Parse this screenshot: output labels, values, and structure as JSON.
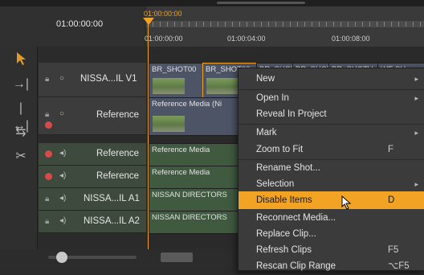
{
  "timeline": {
    "current_timecode": "01:00:00:00",
    "playhead_timecode": "01:00:00:00",
    "ruler_ticks": [
      "01:00:00:00",
      "01:00:04:00",
      "01:00:08:00"
    ]
  },
  "tools": [
    {
      "icon": "selection-arrow-icon"
    },
    {
      "icon": "track-select-icon"
    },
    {
      "icon": "ripple-edit-icon"
    },
    {
      "icon": "slip-tool-icon"
    },
    {
      "icon": "razor-tool-icon"
    }
  ],
  "tracks": [
    {
      "name": "NISSA...IL V1",
      "kind": "video"
    },
    {
      "name": "Reference",
      "kind": "video"
    },
    {
      "name": "Reference",
      "kind": "audio"
    },
    {
      "name": "Reference",
      "kind": "audio"
    },
    {
      "name": "NISSA...IL A1",
      "kind": "audio"
    },
    {
      "name": "NISSA...IL A2",
      "kind": "audio"
    }
  ],
  "clips": {
    "v1": [
      "BR_SHOT00",
      "BR_SHOT00",
      "BR_SHOT",
      "BR_SHOT",
      "BR_SHOTV",
      "WE SH"
    ],
    "ref_video": "Reference Media (Ni",
    "ref_audio1": "Reference Media",
    "ref_audio2": "Reference Media",
    "a1": "NISSAN DIRECTORS",
    "a2": "NISSAN DIRECTORS"
  },
  "context_menu": {
    "items": [
      {
        "label": "New",
        "shortcut": "",
        "submenu": true
      },
      {
        "label": "Open In",
        "shortcut": "",
        "submenu": true
      },
      {
        "label": "Reveal In Project",
        "shortcut": "",
        "submenu": false
      },
      {
        "label": "Mark",
        "shortcut": "",
        "submenu": true
      },
      {
        "label": "Zoom to Fit",
        "shortcut": "F",
        "submenu": false
      },
      {
        "label": "Rename Shot...",
        "shortcut": "",
        "submenu": false
      },
      {
        "label": "Selection",
        "shortcut": "",
        "submenu": true
      },
      {
        "label": "Disable Items",
        "shortcut": "D",
        "submenu": false,
        "highlighted": true
      },
      {
        "label": "Reconnect Media...",
        "shortcut": "",
        "submenu": false
      },
      {
        "label": "Replace Clip...",
        "shortcut": "",
        "submenu": false
      },
      {
        "label": "Refresh Clips",
        "shortcut": "F5",
        "submenu": false
      },
      {
        "label": "Rescan Clip Range",
        "shortcut": "⌥F5",
        "submenu": false
      }
    ],
    "highlight_color": "#f2a324"
  },
  "colors": {
    "playhead": "#f0a12a",
    "video_clip": "#4d5466",
    "audio_clip": "#3f5a3f"
  }
}
